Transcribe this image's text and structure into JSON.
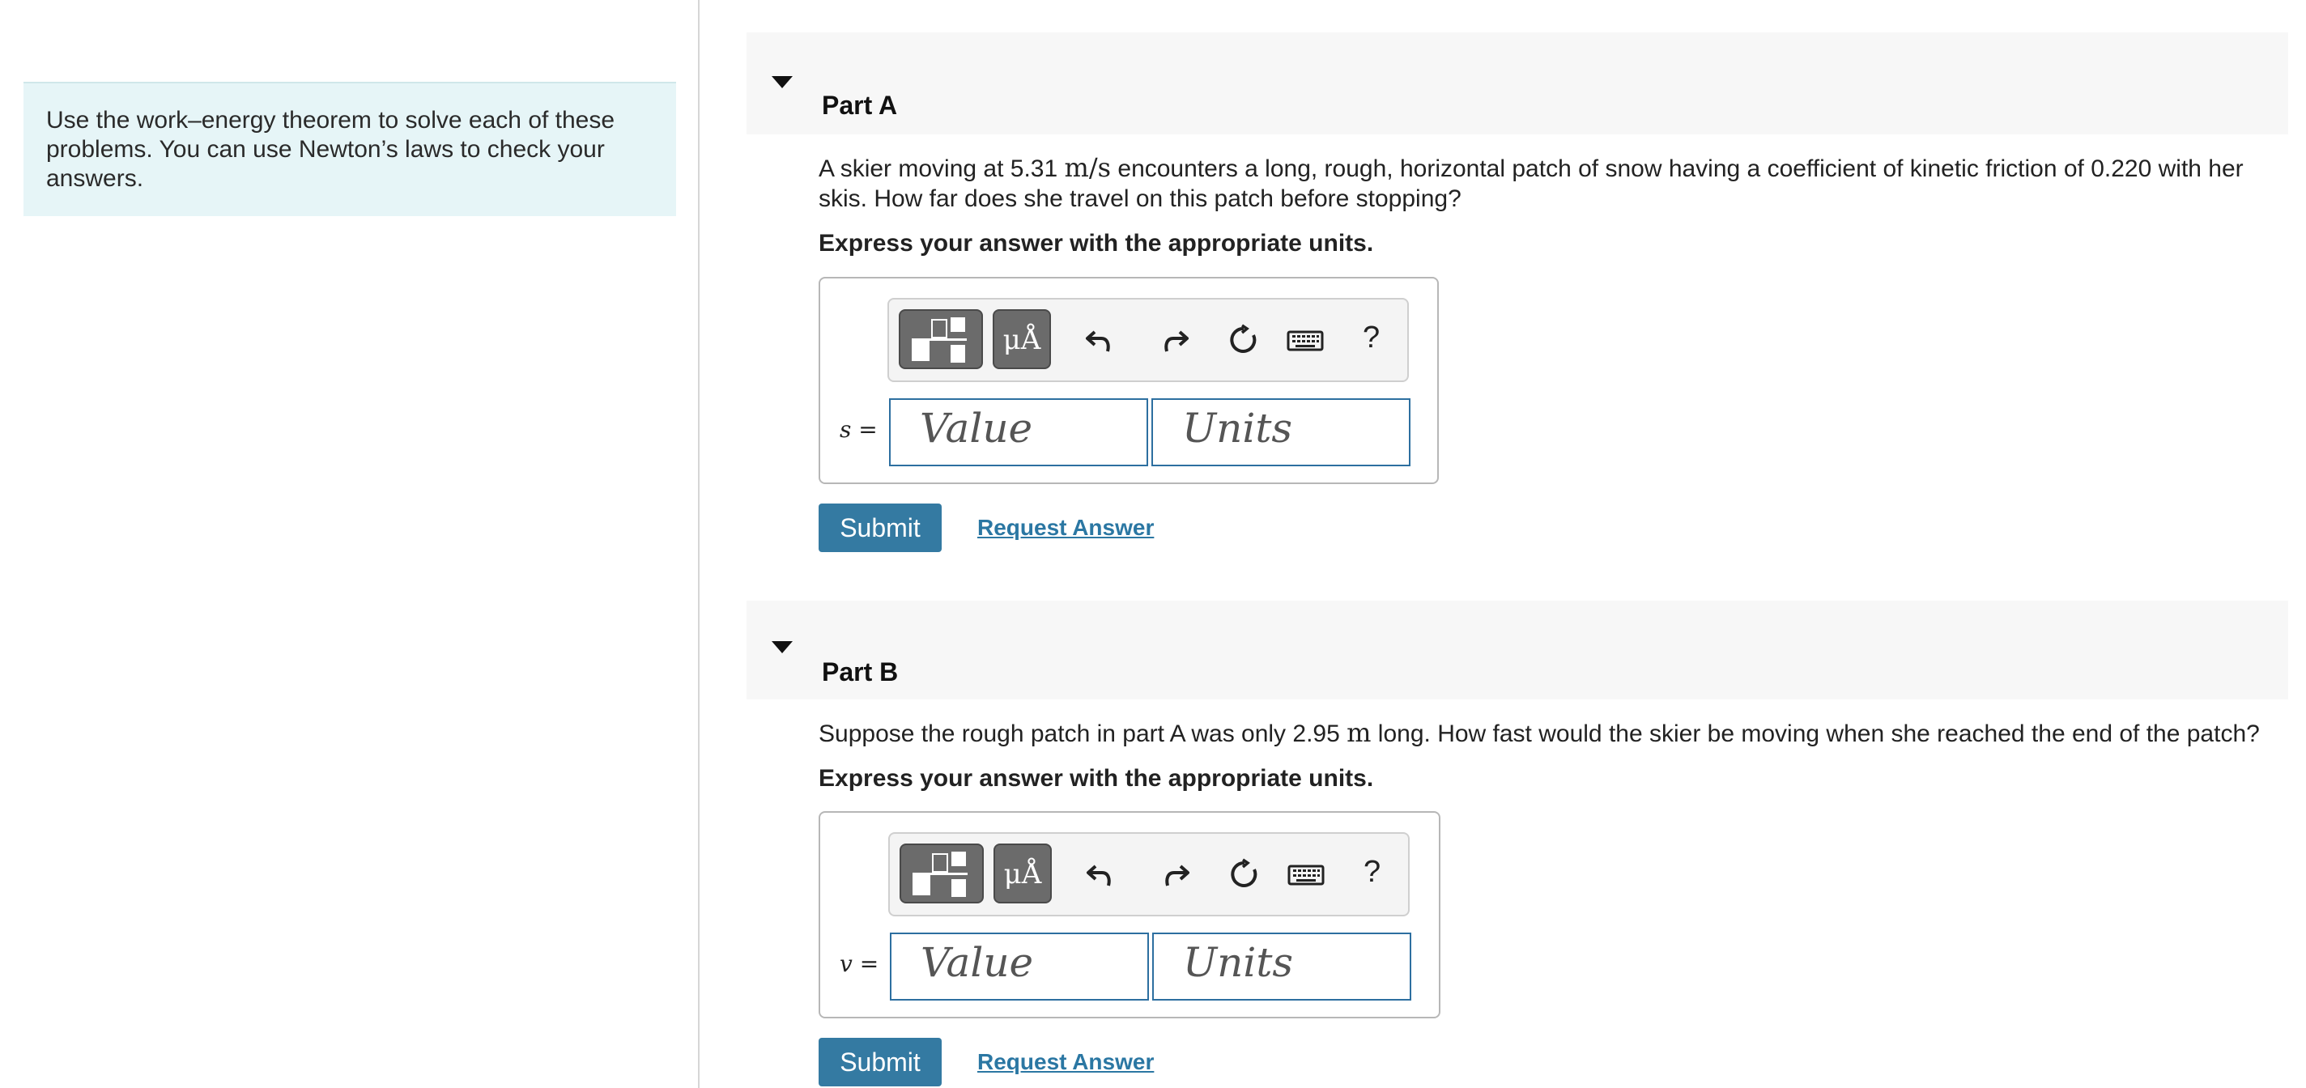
{
  "sidebar": {
    "instructions": "Use the work–energy theorem to solve each of these problems. You can use Newton’s laws to check your answers."
  },
  "toolbar": {
    "mu_label": "μÅ",
    "help_label": "?"
  },
  "parts": [
    {
      "title": "Part A",
      "question_pre": "A skier moving at 5.31 ",
      "question_unit": "m/s",
      "question_post": " encounters a long, rough, horizontal patch of snow having a coefficient of kinetic friction of 0.220 with her skis. How far does she travel on this patch before stopping?",
      "instruction": "Express your answer with the appropriate units.",
      "variable": "s",
      "equals": "=",
      "value_placeholder": "Value",
      "units_placeholder": "Units",
      "submit_label": "Submit",
      "request_label": "Request Answer"
    },
    {
      "title": "Part B",
      "question_pre": "Suppose the rough patch in part A was only 2.95 ",
      "question_unit": "m",
      "question_post": " long. How fast would the skier be moving when she reached the end of the patch?",
      "instruction": "Express your answer with the appropriate units.",
      "variable": "v",
      "equals": "=",
      "value_placeholder": "Value",
      "units_placeholder": "Units",
      "submit_label": "Submit",
      "request_label": "Request Answer"
    }
  ]
}
